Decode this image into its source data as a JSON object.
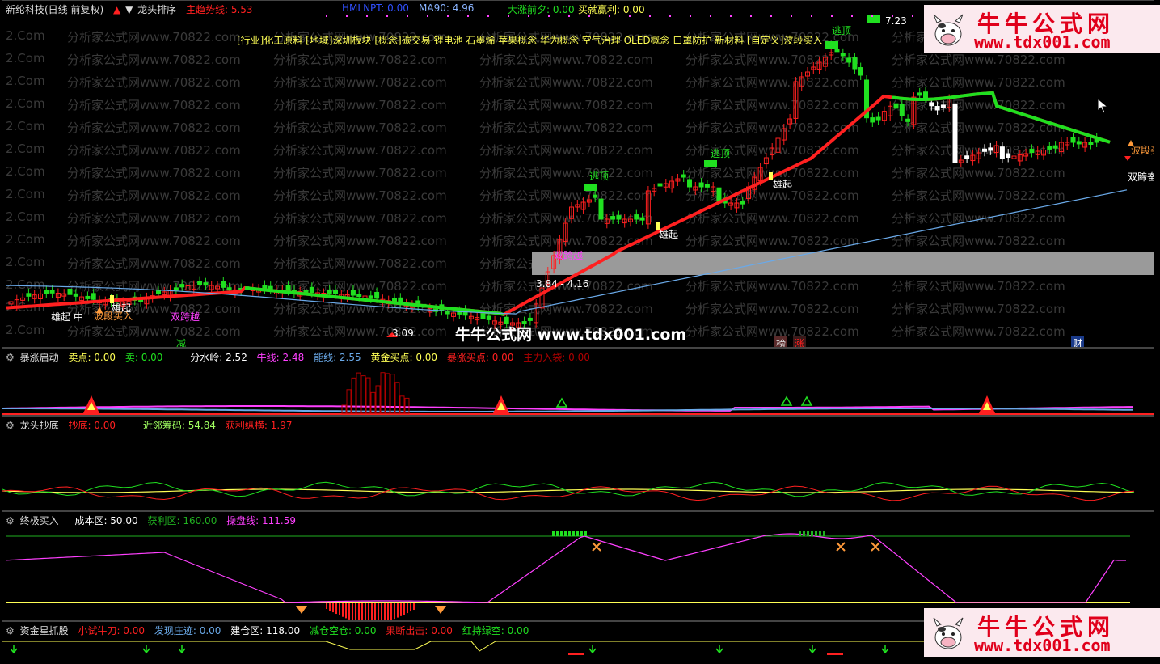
{
  "main": {
    "stock_name": "新纶科技(日线 前复权)",
    "indicator_name": "龙头排序",
    "trend_label": "主趋势线: 5.53",
    "hmlnpt_label": "HMLNPT: 0.00",
    "ma90_label": "MA90: 4.96",
    "rise_label": "大涨前夕: 0.00",
    "profit_label": "买就赢利: 0.00",
    "concepts": "[行业]化工原料 [地域]深圳板块 [概念]碳交易 锂电池 石墨烯 苹果概念 华为概念 空气治理 OLED概念 口罩防护 新材料 [自定义]波段买入",
    "price_high": "7.23",
    "price_low": "3.09",
    "price_range": "3.84 - 4.16",
    "signals": {
      "escape1": "逃顶",
      "escape2": "逃顶",
      "escape3": "逃顶",
      "rise1": "雄起",
      "rise2": "雄起",
      "rise3": "雄起",
      "rise4": "雄起",
      "double_cross1": "双跨越",
      "double_cross2": "双跨越",
      "band_buy1": "波段买入",
      "band_buy2": "波段买",
      "double_hoof": "双蹄奋",
      "mid": "中",
      "reduce": "减",
      "rank": "榜",
      "rise_tag": "涨",
      "fortune": "财"
    }
  },
  "panel2": {
    "title": "暴涨启动",
    "sell_point": "卖点: 0.00",
    "sell": "卖: 0.00",
    "watershed": "分水岭: 2.52",
    "bull_line": "牛线: 2.48",
    "energy_line": "能线: 2.55",
    "gold_buy": "黄金买点: 0.00",
    "surge_buy": "暴涨买点: 0.00",
    "main_enter": "主力入袋: 0.00"
  },
  "panel3": {
    "title": "龙头抄底",
    "bottom": "抄底: 0.00",
    "near_chips": "近邻筹码: 54.84",
    "profit_lock": "获利纵横: 1.97"
  },
  "panel4": {
    "title": "终极买入",
    "cost_zone": "成本区: 50.00",
    "profit_zone": "获利区: 160.00",
    "control_line": "操盘线: 111.59"
  },
  "panel5": {
    "title": "资金星抓股",
    "small_knife": "小试牛刀: 0.00",
    "track": "发现庄迹: 0.00",
    "build_zone": "建仓区: 118.00",
    "reduce_empty": "减仓空仓: 0.00",
    "decisive_out": "果断出击: 0.00",
    "red_green": "红持绿空: 0.00"
  },
  "watermarks": {
    "grid_text": "分析家公式网www.70822.com",
    "left_text": "2.Com",
    "center": "牛牛公式网 www.tdx001.com"
  },
  "badge": {
    "title": "牛牛公式网",
    "url": "www.tdx001.com"
  },
  "colors": {
    "up": "#ff2020",
    "down": "#20e020",
    "trend": "#ff2020",
    "ma90": "#6aa9e8",
    "label_yellow": "#ffff55",
    "label_magenta": "#ff40ff"
  }
}
